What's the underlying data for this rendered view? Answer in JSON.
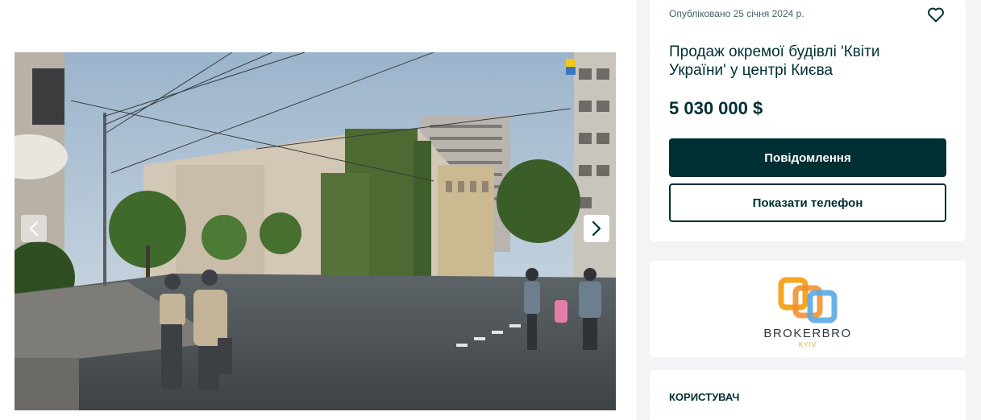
{
  "gallery": {
    "image_alt": "Продаж окремої будівлі 'Квіти України' у центрі Києва",
    "prev_icon": "chevron-left-icon",
    "next_icon": "chevron-right-icon"
  },
  "listing": {
    "published": "Опубліковано 25 січня 2024 р.",
    "favorite_icon": "heart-outline-icon",
    "title": "Продаж окремої будівлі 'Квіти України' у центрі Києва",
    "price": "5 030 000 $",
    "message_button": "Повідомлення",
    "phone_button": "Показати телефон"
  },
  "seller": {
    "logo_name": "BROKERBRO",
    "logo_city": "KYIV"
  },
  "user_section": {
    "label": "КОРИСТУВАЧ"
  },
  "colors": {
    "primary": "#002f34",
    "muted_text": "#406367",
    "page_side_bg": "#f2f4f5",
    "logo_orange": "#f5a623",
    "logo_blue": "#5aa9e6"
  }
}
